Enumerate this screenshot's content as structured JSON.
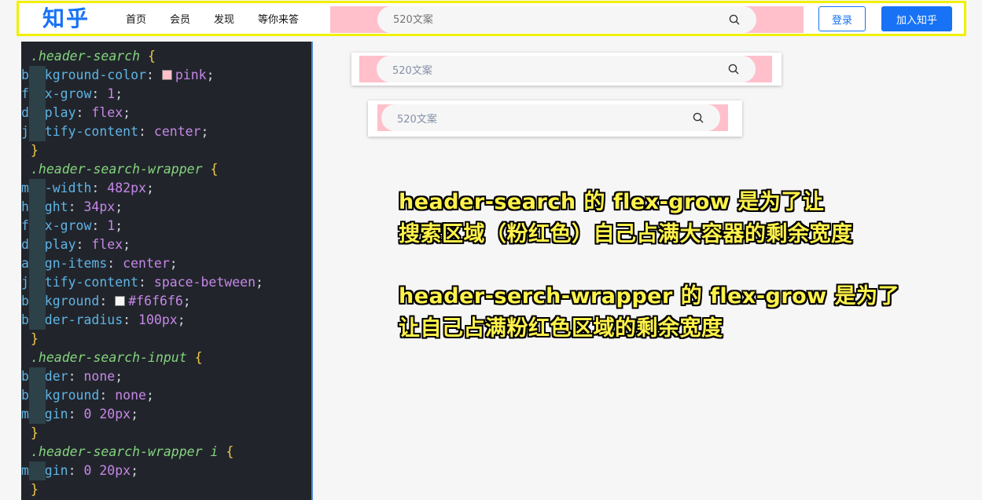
{
  "header": {
    "logo": "知乎",
    "nav": [
      "首页",
      "会员",
      "发现",
      "等你来答"
    ],
    "search_placeholder": "520文案",
    "login_label": "登录",
    "join_label": "加入知乎"
  },
  "code": {
    "blocks": [
      {
        "selector": ".header-search",
        "decls": [
          {
            "prop": "background-color",
            "val": "pink",
            "swatch": "#ffc0cb"
          },
          {
            "prop": "flex-grow",
            "val": "1"
          },
          {
            "prop": "display",
            "val": "flex"
          },
          {
            "prop": "justify-content",
            "val": "center"
          }
        ]
      },
      {
        "selector": ".header-search-wrapper",
        "decls": [
          {
            "prop": "max-width",
            "val": "482px"
          },
          {
            "prop": "height",
            "val": "34px"
          },
          {
            "prop": "flex-grow",
            "val": "1"
          },
          {
            "prop": "display",
            "val": "flex"
          },
          {
            "prop": "align-items",
            "val": "center"
          },
          {
            "prop": "justify-content",
            "val": "space-between"
          },
          {
            "prop": "background",
            "val": "#f6f6f6",
            "swatch": "#f6f6f6"
          },
          {
            "prop": "border-radius",
            "val": "100px"
          }
        ]
      },
      {
        "selector": ".header-search-input",
        "decls": [
          {
            "prop": "border",
            "val": "none"
          },
          {
            "prop": "background",
            "val": "none"
          },
          {
            "prop": "margin",
            "val": "0 20px"
          }
        ]
      },
      {
        "selector": ".header-search-wrapper i",
        "decls": [
          {
            "prop": "margin",
            "val": "0 20px"
          }
        ]
      }
    ]
  },
  "demos": [
    {
      "placeholder": "520文案"
    },
    {
      "placeholder": "520文案"
    }
  ],
  "notes": {
    "line1": "header-search 的 flex-grow 是为了让",
    "line2": "搜索区域（粉红色）自己占满大容器的剩余宽度",
    "line3": "header-serch-wrapper 的 flex-grow 是为了",
    "line4": "让自己占满粉红色区域的剩余宽度"
  },
  "colors": {
    "brand": "#1772f6",
    "highlight_border": "#f0f000",
    "pink": "#ffc0cb",
    "search_bg": "#f6f6f6",
    "code_bg": "#21252b",
    "note_text": "#fff24a"
  }
}
